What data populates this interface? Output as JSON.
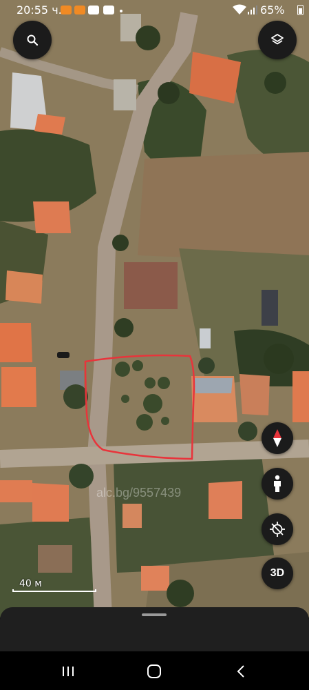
{
  "status_bar": {
    "time": "20:55 ч.",
    "battery_percent": "65%",
    "battery_level": 0.65,
    "notification_icons": [
      "ok-app-icon",
      "ok-app-icon",
      "youtube-icon",
      "youtube-icon"
    ]
  },
  "map": {
    "view": "satellite",
    "scale_label": "40 м",
    "watermark": "alc.bg/9557439",
    "accent_color": "#e8343b"
  },
  "controls": {
    "search": "search-icon",
    "layers": "layers-icon",
    "compass": "compass-icon",
    "street_view": "pegman-icon",
    "location": "location-off-icon",
    "three_d_label": "3D"
  }
}
